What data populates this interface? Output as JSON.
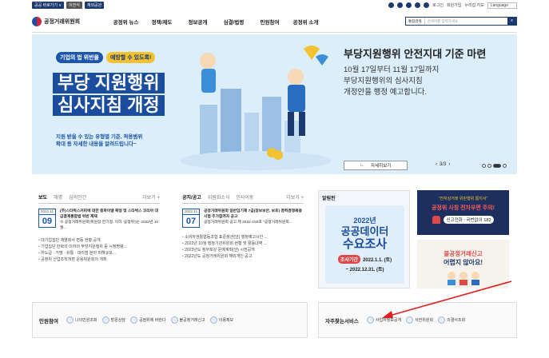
{
  "topbar": {
    "links": [
      "공공 바로가기 ∨",
      "이전식",
      "재외공관"
    ],
    "right": [
      "로그인",
      "회원가입",
      "누리집 지도"
    ],
    "language": "Language"
  },
  "header": {
    "logo": "공정거래위원회",
    "nav": [
      "공정위 뉴스",
      "정책/제도",
      "정보공개",
      "심결/법령",
      "민원참여",
      "공정위 소개"
    ],
    "search_select": "통합검색",
    "search_placeholder": "검색어를 입력하세요."
  },
  "hero": {
    "pill1": "기업의 법 위반을",
    "pill2": "예방할 수 있도록!",
    "big1": "부당 지원행위",
    "big2": "심사지침 개정",
    "sub1": "지원 받을 수 있는 유형별 기준, 적용범위",
    "sub2": "확대 등 자세한 내용을 알려드립니다~",
    "title": "부당지원행위 안전지대 기준 마련",
    "desc1": "10월 17일부터 11월 17일까지",
    "desc2": "부당지원행위의 심사지침",
    "desc3": "개정안을 행정 예고합니다.",
    "more": "자세히보기",
    "pager": "3/3"
  },
  "news": {
    "tabs": [
      "보도",
      "해명",
      "심의인건"
    ],
    "more": "더보기 +",
    "date_ym": "2022.11",
    "date_d": "09",
    "feature": "(주)스타벅스커피에 대한 총파이넬 확정 및 스타벅스 코리아 대금결제통합법 위반 제재",
    "feature2": "ㅁ 공정거래위원회(위원장 한기정, 이하 '공정위')는 2022년 10월...",
    "items": [
      "대기업집단 계열회사 변동 현황 공개",
      "기업집단 한화의 이하의 부당지원행위 등 시정명령...",
      "하도급 · 가맹 · 유통 · 대리점 분야 피해규모...",
      "공정위 산업조직개편 운용위원회의 개최"
    ]
  },
  "notice": {
    "tabs": [
      "공지/공고",
      "위원회소식",
      "인사이동"
    ],
    "more": "더보기 +",
    "date_ym": "2022.11",
    "date_d": "07",
    "feature": "공정거래위원회 일반임기제 7급(정보보안, 보호) 경력경쟁채용시험 추가합격자 공고",
    "feature2": "공정거래위원회 공고 제 2022-150호 \"공정거래위원회...",
    "items": [
      "소비자생활협동조합 표준정관(안) 행정예고시안 ...",
      "2022년 10월 행정기관위원회 현황 및 활동내역 ...",
      "2023년도 정부포상 문예계획(안) 시전공개",
      "2022년도 공정거래위원회 해외개인 공고"
    ]
  },
  "popup": {
    "title": "알림판",
    "year_label": "2022년",
    "big1": "공공데이터",
    "big2": "수요조사",
    "period_label": "조사기간",
    "period1": "2022.1.1. (토)",
    "period2": "~ 2022.12.31. (토)"
  },
  "banner1": {
    "line1": "\"전자상거래 위반행위 통지서\"",
    "line2": "공정위 사칭 전자우편 주의!",
    "line3": "신고전화 : 국번없이 182"
  },
  "banner2": {
    "line1": "불공정거래신고",
    "line2": "어렵지 않아요!"
  },
  "services": {
    "title": "민원참여",
    "items": [
      "나의민원조회",
      "방문상담",
      "공정위에 바란다",
      "불공정거래신고",
      "이용제보"
    ]
  },
  "quick": {
    "title": "자주찾는서비스",
    "items": [
      "사업자정보공개",
      "사전위원회",
      "의결서조회"
    ]
  },
  "colors": {
    "brand": "#1d3a6e",
    "accent": "#1d55a8",
    "red": "#c8283b"
  }
}
